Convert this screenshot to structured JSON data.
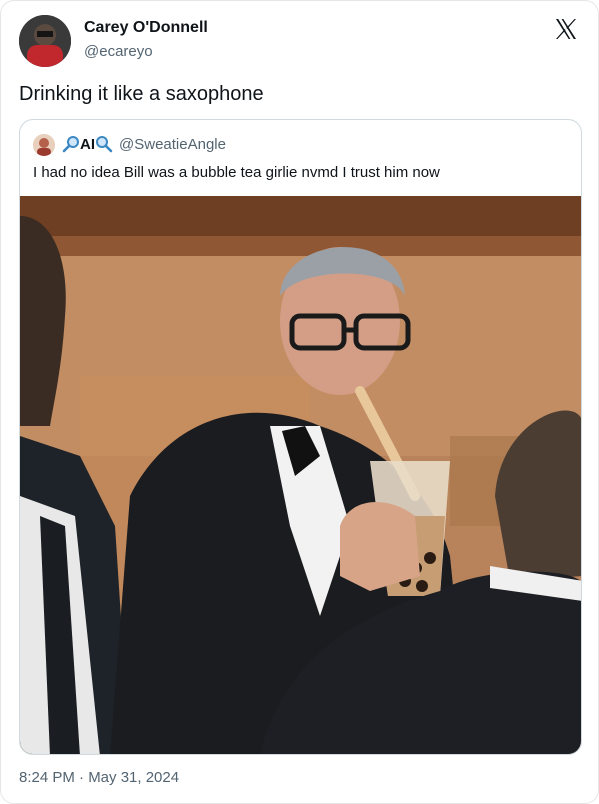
{
  "tweet": {
    "author_name": "Carey O'Donnell",
    "author_handle": "@ecareyo",
    "text": "Drinking it like a saxophone",
    "timestamp": "8:24 PM · May 31, 2024",
    "platform_icon": "x-logo-icon"
  },
  "quoted_tweet": {
    "author_name": "AI",
    "author_handle": "@SweatieAngle",
    "text": "I had no idea Bill was a bubble tea girlie nvmd I trust him now",
    "name_icons": [
      "magnifying-glass-left-icon",
      "magnifying-glass-right-icon"
    ]
  },
  "colors": {
    "primary_text": "#0f1419",
    "secondary_text": "#536471",
    "border": "#cfd9de"
  }
}
